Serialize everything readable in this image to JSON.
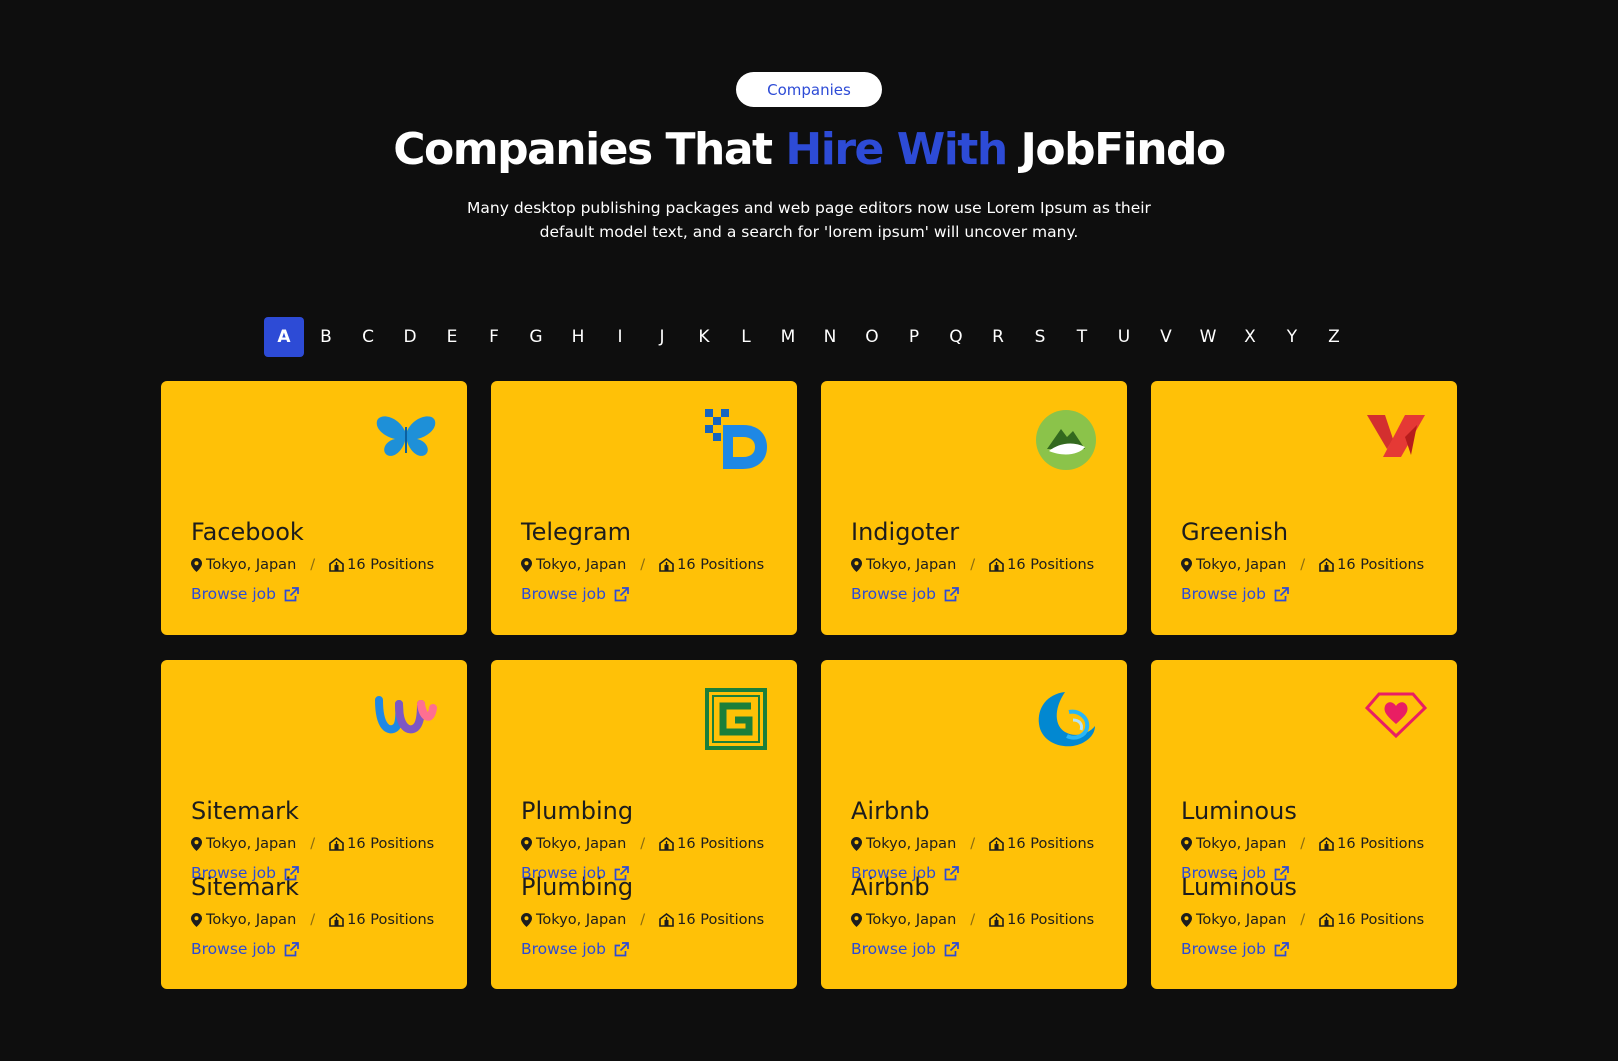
{
  "header": {
    "badge": "Companies",
    "title_part1": "Companies That ",
    "title_accent": "Hire With",
    "title_part2": " JobFindo",
    "subtitle": "Many desktop publishing packages and web page editors now use Lorem Ipsum as their default model text, and a search for 'lorem ipsum' will uncover many."
  },
  "alphabet": {
    "active": "A",
    "letters": [
      "A",
      "B",
      "C",
      "D",
      "E",
      "F",
      "G",
      "H",
      "I",
      "J",
      "K",
      "L",
      "M",
      "N",
      "O",
      "P",
      "Q",
      "R",
      "S",
      "T",
      "U",
      "V",
      "W",
      "X",
      "Y",
      "Z"
    ]
  },
  "colors": {
    "accent": "#2d4bd6",
    "card": "#ffc107",
    "background": "#0e0e0e"
  },
  "companies": [
    {
      "name": "Facebook",
      "location": "Tokyo, Japan",
      "positions": "16 Positions",
      "link": "Browse job",
      "icon": "butterfly-logo-icon"
    },
    {
      "name": "Telegram",
      "location": "Tokyo, Japan",
      "positions": "16 Positions",
      "link": "Browse job",
      "icon": "pixel-d-logo-icon"
    },
    {
      "name": "Indigoter",
      "location": "Tokyo, Japan",
      "positions": "16 Positions",
      "link": "Browse job",
      "icon": "mountain-leaf-logo-icon"
    },
    {
      "name": "Greenish",
      "location": "Tokyo, Japan",
      "positions": "16 Positions",
      "link": "Browse job",
      "icon": "red-v-logo-icon"
    },
    {
      "name": "Sitemark",
      "location": "Tokyo, Japan",
      "positions": "16 Positions",
      "link": "Browse job",
      "icon": "w-logo-icon"
    },
    {
      "name": "Plumbing",
      "location": "Tokyo, Japan",
      "positions": "16 Positions",
      "link": "Browse job",
      "icon": "g-square-logo-icon"
    },
    {
      "name": "Airbnb",
      "location": "Tokyo, Japan",
      "positions": "16 Positions",
      "link": "Browse job",
      "icon": "wave-logo-icon"
    },
    {
      "name": "Luminous",
      "location": "Tokyo, Japan",
      "positions": "16 Positions",
      "link": "Browse job",
      "icon": "heart-diamond-logo-icon"
    }
  ]
}
